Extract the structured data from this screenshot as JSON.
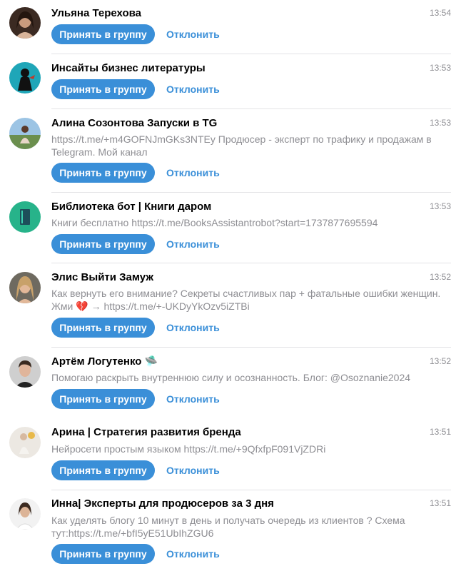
{
  "requests": [
    {
      "name": "Ульяна Терехова",
      "time": "13:54",
      "bio": "",
      "accept_label": "Принять в группу",
      "decline_label": "Отклонить",
      "avatar_icon": "user-photo-woman-dark-hair"
    },
    {
      "name": "Инсайты бизнес литературы",
      "time": "13:53",
      "bio": "",
      "accept_label": "Принять в группу",
      "decline_label": "Отклонить",
      "avatar_icon": "channel-photo-teal-figure"
    },
    {
      "name": "Алина Созонтова Запуски в TG",
      "time": "13:53",
      "bio": "https://t.me/+m4GOFNJmGKs3NTEy Продюсер - эксперт по трафику и продажам в Telegram. Мой канал",
      "accept_label": "Принять в группу",
      "decline_label": "Отклонить",
      "avatar_icon": "user-photo-outdoor"
    },
    {
      "name": "Библиотека бот | Книги даром",
      "time": "13:53",
      "bio": "Книги бесплатно https://t.me/BooksAssistantrobot?start=1737877695594",
      "accept_label": "Принять в группу",
      "decline_label": "Отклонить",
      "avatar_icon": "book-icon"
    },
    {
      "name": "Элис Выйти Замуж",
      "time": "13:52",
      "bio_text": "Как вернуть его внимание? Секреты счастливых пар + фатальные ошибки женщин. Жми",
      "bio_emoji": "💔",
      "bio_link": "→ https://t.me/+-UKDyYkOzv5iZTBi",
      "accept_label": "Принять в группу",
      "decline_label": "Отклонить",
      "avatar_icon": "user-photo-blonde-woman"
    },
    {
      "name": "Артём Логутенко 🛸",
      "time": "13:52",
      "bio": "Помогаю раскрыть внутреннюю силу и осознанность. Блог: @Osoznanie2024",
      "accept_label": "Принять в группу",
      "decline_label": "Отклонить",
      "avatar_icon": "user-photo-man"
    },
    {
      "name": "Арина | Стратегия развития бренда",
      "time": "13:51",
      "bio": "Нейросети простым языком https://t.me/+9QfxfpF091VjZDRi",
      "accept_label": "Принять в группу",
      "decline_label": "Отклонить",
      "avatar_icon": "user-photo-woman-light"
    },
    {
      "name": "Инна| Эксперты для продюсеров за 3 дня",
      "time": "13:51",
      "bio": "Как уделять блогу 10 минут в день и получать очередь из клиентов ? Схема тут:https://t.me/+bfI5yE51UbIhZGU6",
      "accept_label": "Принять в группу",
      "decline_label": "Отклонить",
      "avatar_icon": "user-photo-woman-white"
    }
  ]
}
